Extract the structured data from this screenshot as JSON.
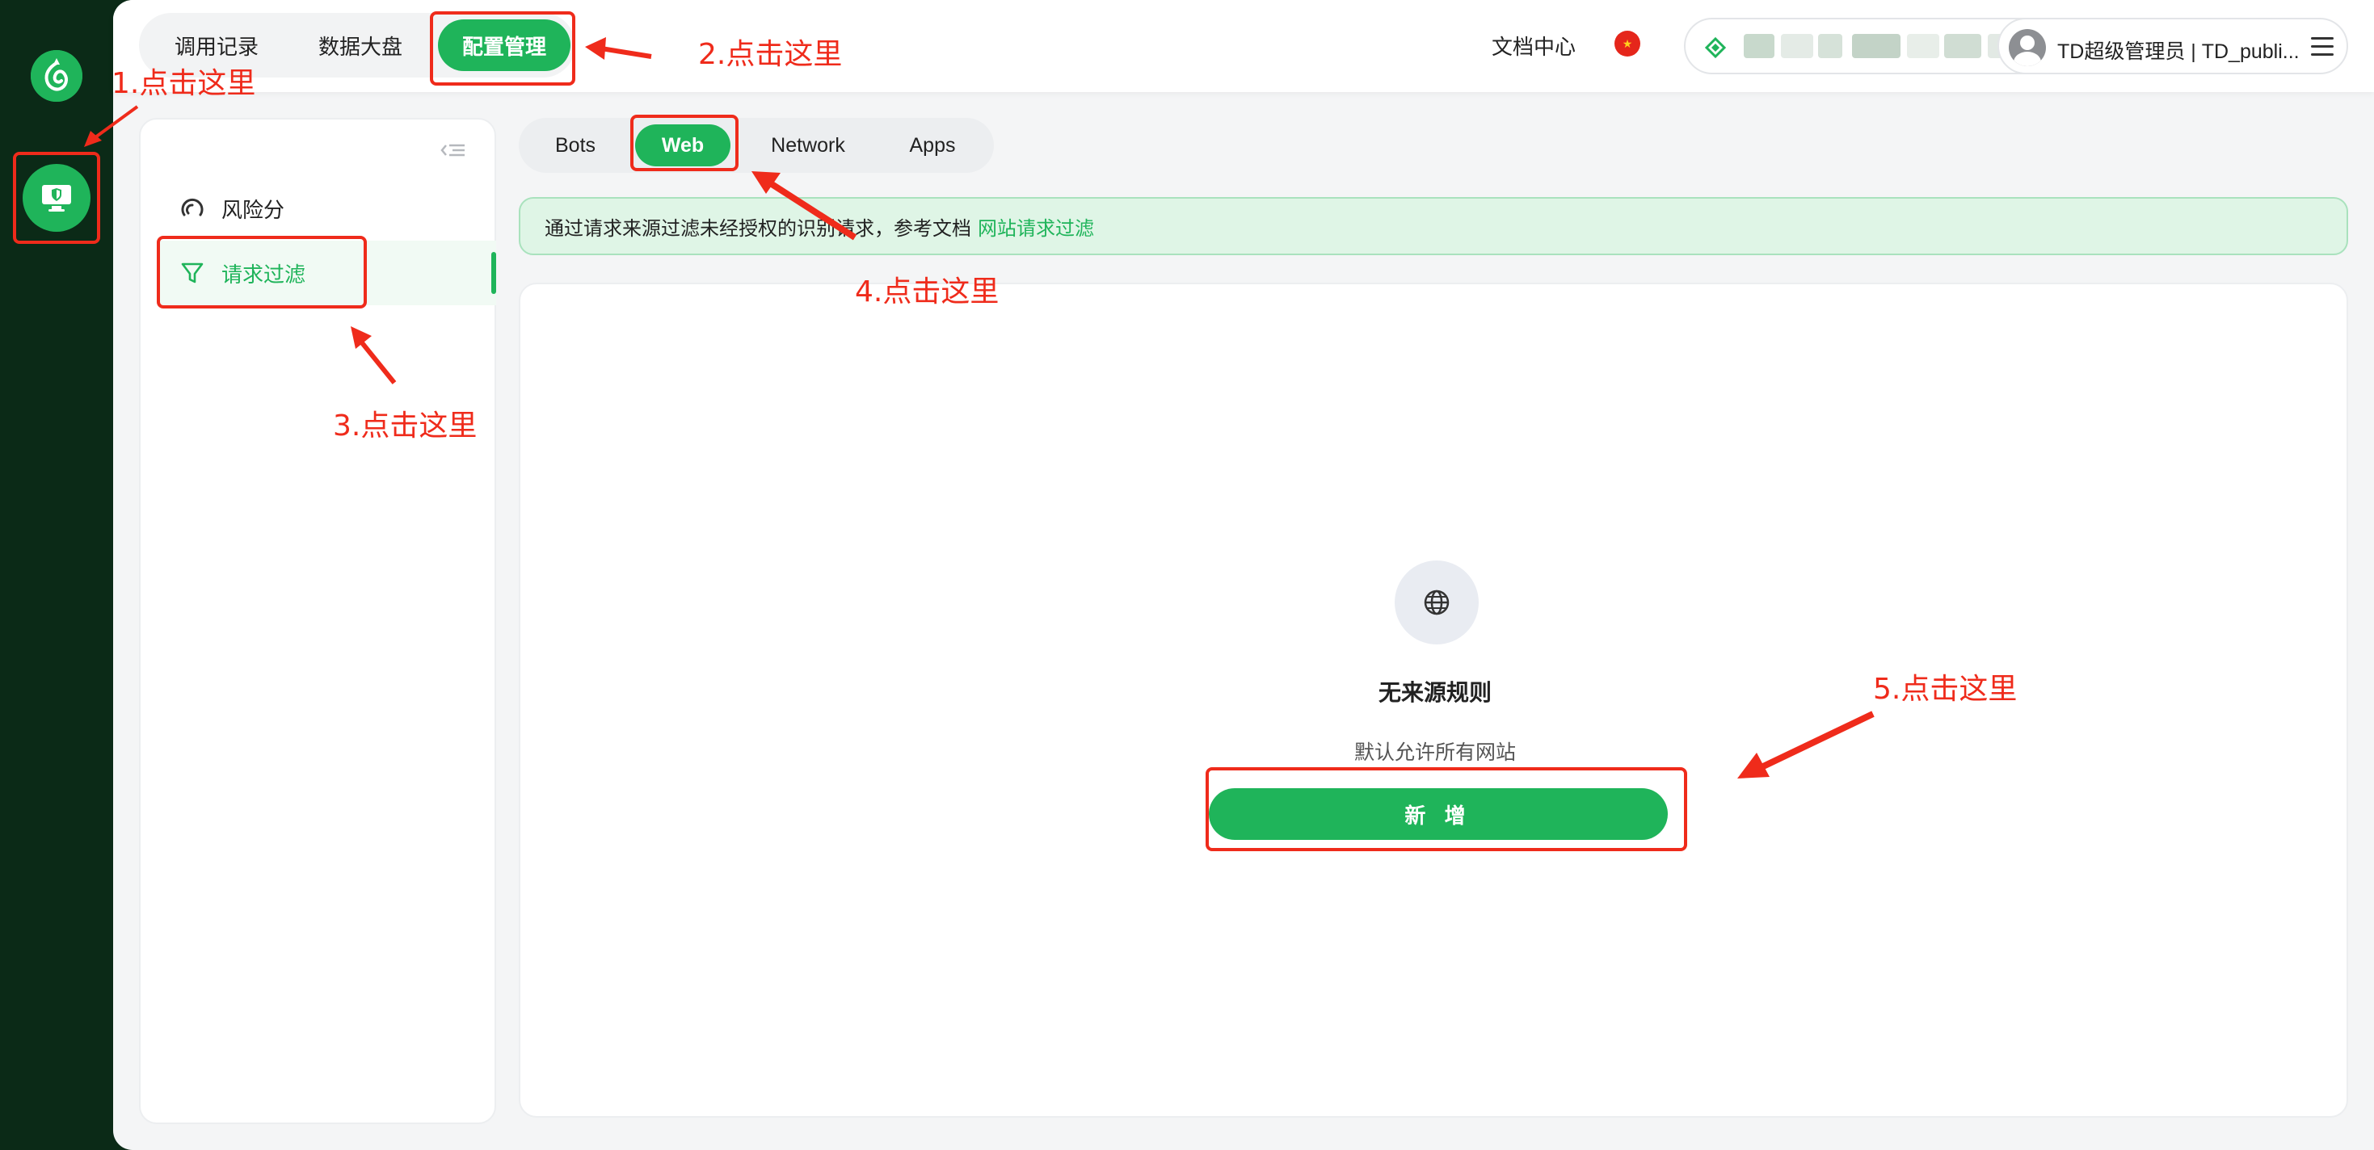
{
  "top_tabs": [
    {
      "label": "调用记录"
    },
    {
      "label": "数据大盘"
    },
    {
      "label": "配置管理"
    }
  ],
  "header": {
    "doc_center": "文档中心",
    "user_label": "TD超级管理员 | TD_publi..."
  },
  "sidebar": {
    "items": [
      {
        "label": "风险分"
      },
      {
        "label": "请求过滤"
      }
    ]
  },
  "segments": [
    {
      "label": "Bots"
    },
    {
      "label": "Web"
    },
    {
      "label": "Network"
    },
    {
      "label": "Apps"
    }
  ],
  "notice": {
    "text": "通过请求来源过滤未经授权的识别请求，参考文档",
    "link": "网站请求过滤"
  },
  "empty_state": {
    "title": "无来源规则",
    "subtitle": "默认允许所有网站",
    "button": "新 增"
  },
  "annotations": {
    "a1": "1.点击这里",
    "a2": "2.点击这里",
    "a3": "3.点击这里",
    "a4": "4.点击这里",
    "a5": "5.点击这里"
  },
  "colors": {
    "brand_green": "#1fb45a",
    "rail_dark": "#0b2a17",
    "annotation_red": "#ef2b1b"
  }
}
